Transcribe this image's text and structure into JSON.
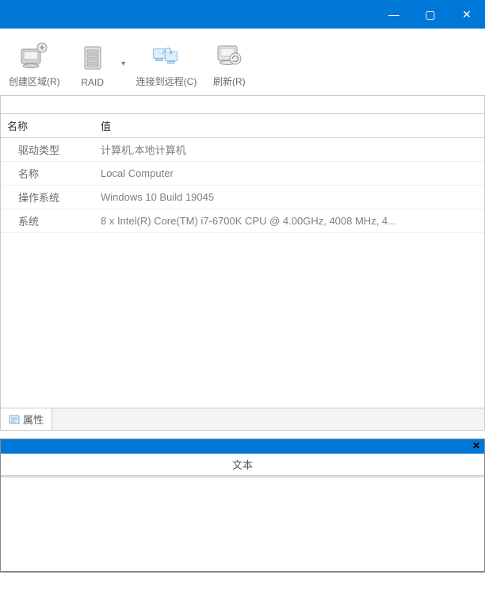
{
  "titlebar": {
    "minimize_glyph": "—",
    "maximize_glyph": "▢",
    "close_glyph": "✕"
  },
  "toolbar": {
    "items": [
      {
        "id": "create-region",
        "label": "创建区域(R)",
        "split": false
      },
      {
        "id": "raid",
        "label": "RAID",
        "split": true
      },
      {
        "id": "connect-remote",
        "label": "连接到远程(C)",
        "split": false
      },
      {
        "id": "refresh",
        "label": "刷新(R)",
        "split": false
      }
    ],
    "caret_glyph": "▾"
  },
  "propgrid": {
    "columns": {
      "name": "名称",
      "value": "值"
    },
    "rows": [
      {
        "name": "驱动类型",
        "value": "计算机,本地计算机"
      },
      {
        "name": "名称",
        "value": "Local Computer"
      },
      {
        "name": "操作系统",
        "value": "Windows 10 Build 19045"
      },
      {
        "name": "系统",
        "value": "8 x Intel(R) Core(TM) i7-6700K CPU @ 4.00GHz, 4008 MHz, 4..."
      }
    ],
    "tab_label": "属性"
  },
  "lower": {
    "column_header": "文本",
    "close_glyph": "✕"
  }
}
